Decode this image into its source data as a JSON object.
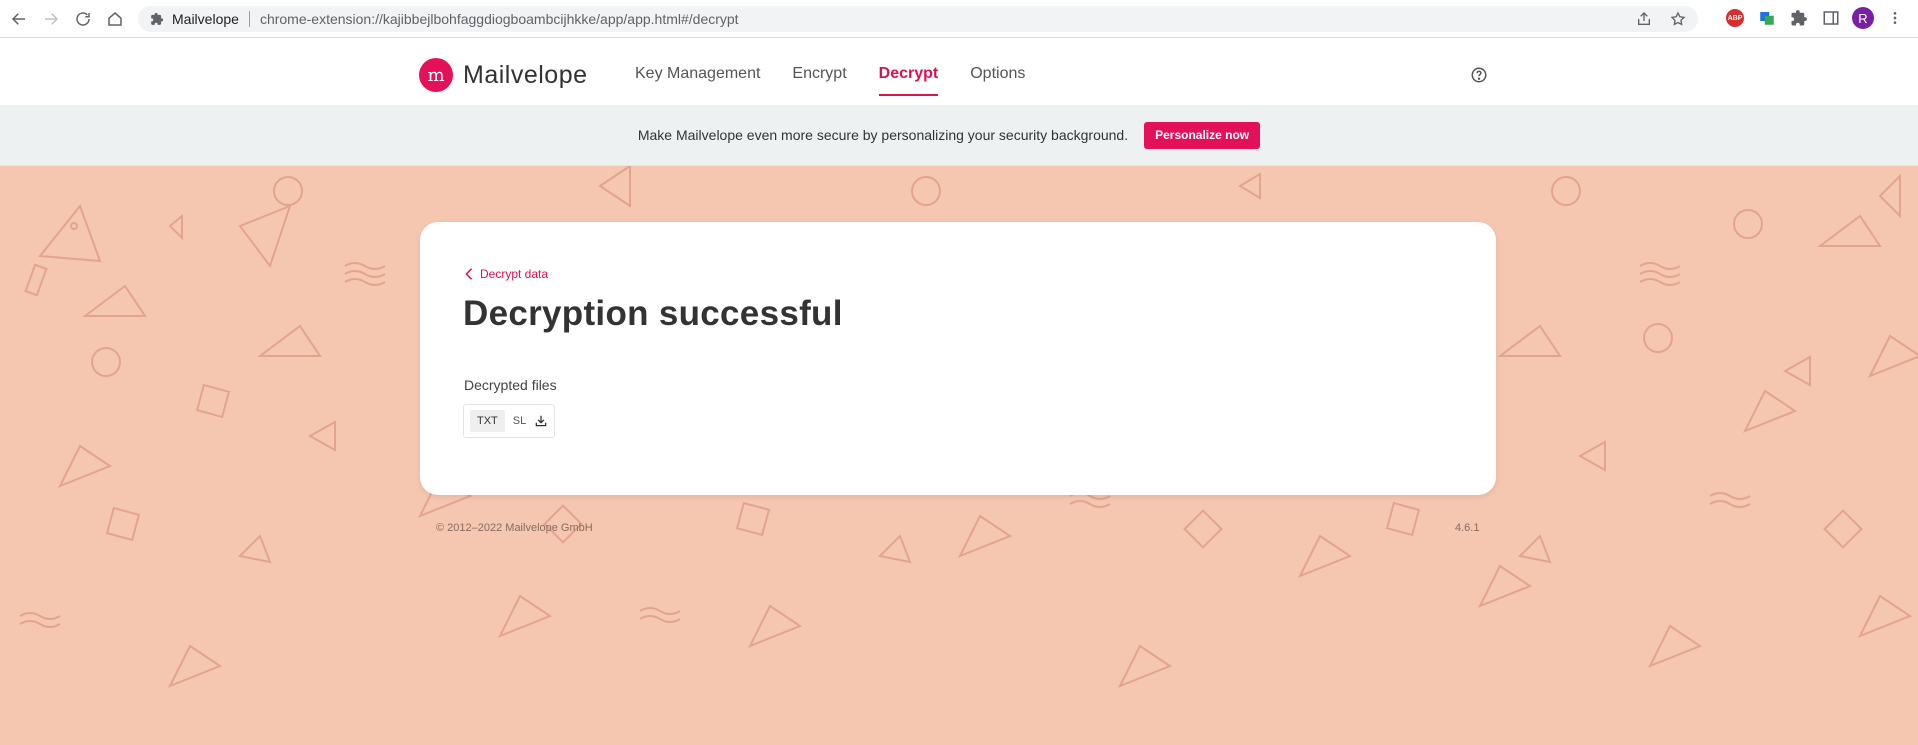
{
  "browser": {
    "site_name": "Mailvelope",
    "url": "chrome-extension://kajibbejlbohfaggdiogboambcijhkke/app/app.html#/decrypt",
    "profile_initial": "R",
    "abp_label": "ABP"
  },
  "header": {
    "logo_text": "Mailvelope",
    "nav": [
      {
        "label": "Key Management"
      },
      {
        "label": "Encrypt"
      },
      {
        "label": "Decrypt"
      },
      {
        "label": "Options"
      }
    ]
  },
  "banner": {
    "text": "Make Mailvelope even more secure by personalizing your security background.",
    "button_label": "Personalize now"
  },
  "card": {
    "back_label": "Decrypt data",
    "title": "Decryption successful",
    "files_label": "Decrypted files",
    "file": {
      "ext": "TXT",
      "name": "SL"
    }
  },
  "footer": {
    "copyright": "© 2012–2022  Mailvelope GmbH",
    "version": "4.6.1"
  },
  "colors": {
    "accent": "#d9134e",
    "background": "#f5c6b0"
  }
}
